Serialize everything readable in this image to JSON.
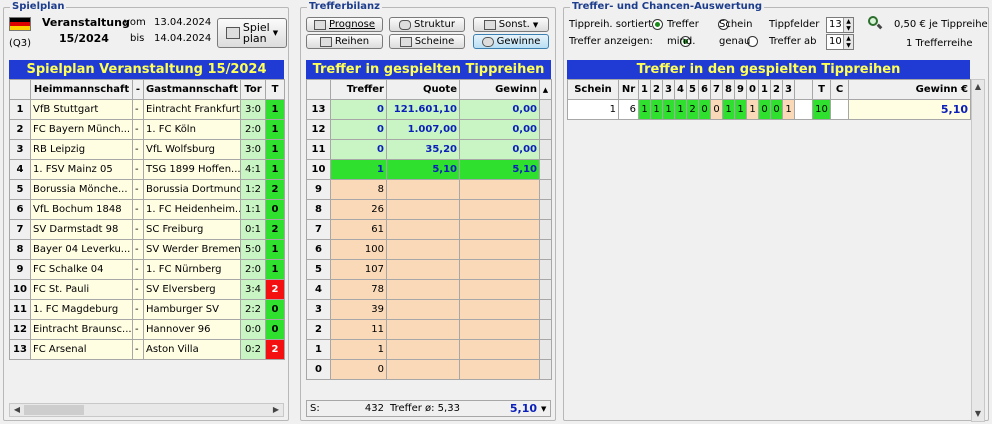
{
  "spielplan": {
    "group_title": "Spielplan",
    "veranstaltung_label": "Veranstaltung",
    "veranstaltung_nr": "15/2024",
    "q_label": "(Q3)",
    "vom_label": "vom",
    "vom_date": "13.04.2024",
    "bis_label": "bis",
    "bis_date": "14.04.2024",
    "btn_line1": "Spiel",
    "btn_line2": "plan",
    "grid_title": "Spielplan Veranstaltung 15/2024",
    "headers": [
      "Heimmannschaft",
      "-",
      "Gastmannschaft",
      "Tor",
      "T"
    ],
    "rows": [
      {
        "nr": "1",
        "home": "VfB Stuttgart",
        "dash": "-",
        "away": "Eintracht Frankfurt",
        "score": "3:0",
        "t": "1",
        "tc": "green"
      },
      {
        "nr": "2",
        "home": "FC Bayern Münch...",
        "dash": "-",
        "away": "1. FC Köln",
        "score": "2:0",
        "t": "1",
        "tc": "green"
      },
      {
        "nr": "3",
        "home": "RB Leipzig",
        "dash": "-",
        "away": "VfL Wolfsburg",
        "score": "3:0",
        "t": "1",
        "tc": "green"
      },
      {
        "nr": "4",
        "home": "1. FSV Mainz 05",
        "dash": "-",
        "away": "TSG 1899 Hoffen...",
        "score": "4:1",
        "t": "1",
        "tc": "green"
      },
      {
        "nr": "5",
        "home": "Borussia Mönche...",
        "dash": "-",
        "away": "Borussia Dortmund",
        "score": "1:2",
        "t": "2",
        "tc": "green"
      },
      {
        "nr": "6",
        "home": "VfL Bochum 1848",
        "dash": "-",
        "away": "1. FC Heidenheim...",
        "score": "1:1",
        "t": "0",
        "tc": "green"
      },
      {
        "nr": "7",
        "home": "SV Darmstadt 98",
        "dash": "-",
        "away": "SC Freiburg",
        "score": "0:1",
        "t": "2",
        "tc": "green"
      },
      {
        "nr": "8",
        "home": "Bayer 04 Leverku...",
        "dash": "-",
        "away": "SV Werder Bremen",
        "score": "5:0",
        "t": "1",
        "tc": "green"
      },
      {
        "nr": "9",
        "home": "FC Schalke 04",
        "dash": "-",
        "away": "1. FC Nürnberg",
        "score": "2:0",
        "t": "1",
        "tc": "green"
      },
      {
        "nr": "10",
        "home": "FC St. Pauli",
        "dash": "-",
        "away": "SV Elversberg",
        "score": "3:4",
        "t": "2",
        "tc": "red"
      },
      {
        "nr": "11",
        "home": "1. FC Magdeburg",
        "dash": "-",
        "away": "Hamburger SV",
        "score": "2:2",
        "t": "0",
        "tc": "green"
      },
      {
        "nr": "12",
        "home": "Eintracht Braunsc...",
        "dash": "-",
        "away": "Hannover 96",
        "score": "0:0",
        "t": "0",
        "tc": "green"
      },
      {
        "nr": "13",
        "home": "FC Arsenal",
        "dash": "-",
        "away": "Aston Villa",
        "score": "0:2",
        "t": "2",
        "tc": "red"
      }
    ]
  },
  "trefferbilanz": {
    "group_title": "Trefferbilanz",
    "buttons": {
      "prognose": "Prognose",
      "struktur": "Struktur",
      "sonst": "Sonst.",
      "reihen": "Reihen",
      "scheine": "Scheine",
      "gewinne": "Gewinne"
    },
    "grid_title": "Treffer in gespielten Tippreihen",
    "headers": [
      "Treffer",
      "Quote",
      "Gewinn"
    ],
    "rows": [
      {
        "k": "13",
        "treffer": "0",
        "quote": "121.601,10",
        "gewinn": "0,00",
        "style": "lgreen"
      },
      {
        "k": "12",
        "treffer": "0",
        "quote": "1.007,00",
        "gewinn": "0,00",
        "style": "lgreen"
      },
      {
        "k": "11",
        "treffer": "0",
        "quote": "35,20",
        "gewinn": "0,00",
        "style": "lgreen"
      },
      {
        "k": "10",
        "treffer": "1",
        "quote": "5,10",
        "gewinn": "5,10",
        "style": "green"
      },
      {
        "k": "9",
        "treffer": "8",
        "quote": "",
        "gewinn": "",
        "style": "peach"
      },
      {
        "k": "8",
        "treffer": "26",
        "quote": "",
        "gewinn": "",
        "style": "peach"
      },
      {
        "k": "7",
        "treffer": "61",
        "quote": "",
        "gewinn": "",
        "style": "peach"
      },
      {
        "k": "6",
        "treffer": "100",
        "quote": "",
        "gewinn": "",
        "style": "peach"
      },
      {
        "k": "5",
        "treffer": "107",
        "quote": "",
        "gewinn": "",
        "style": "peach"
      },
      {
        "k": "4",
        "treffer": "78",
        "quote": "",
        "gewinn": "",
        "style": "peach"
      },
      {
        "k": "3",
        "treffer": "39",
        "quote": "",
        "gewinn": "",
        "style": "peach"
      },
      {
        "k": "2",
        "treffer": "11",
        "quote": "",
        "gewinn": "",
        "style": "peach"
      },
      {
        "k": "1",
        "treffer": "1",
        "quote": "",
        "gewinn": "",
        "style": "peach"
      },
      {
        "k": "0",
        "treffer": "0",
        "quote": "",
        "gewinn": "",
        "style": "peach"
      }
    ],
    "footer": {
      "label": "S:",
      "sum": "432",
      "avg": "Treffer ø:  5,33",
      "gewinn": "5,10"
    }
  },
  "auswertung": {
    "group_title": "Treffer- und Chancen-Auswertung",
    "sortiert_label": "Tippreih. sortiert:",
    "sort_treffer": "Treffer",
    "sort_schein": "Schein",
    "anzeigen_label": "Treffer anzeigen:",
    "anz_mind": "mind.",
    "anz_genau": "genau",
    "tippfelder_label": "Tippfelder",
    "tippfelder_value": "13",
    "treffer_ab_label": "Treffer ab",
    "treffer_ab_value": "10",
    "price": "0,50 € je Tippreihe",
    "reihen_count": "1 Trefferreihe",
    "grid_title": "Treffer in den gespielten Tippreihen",
    "headers": [
      "Schein",
      "Nr",
      "1",
      "2",
      "3",
      "4",
      "5",
      "6",
      "7",
      "8",
      "9",
      "0",
      "1",
      "2",
      "3",
      "",
      "T",
      "C",
      "Gewinn €"
    ],
    "row": {
      "schein": "1",
      "nr": "6",
      "tips": [
        "1",
        "1",
        "1",
        "1",
        "2",
        "0",
        "0",
        "1",
        "1",
        "1",
        "0",
        "0",
        "1"
      ],
      "t": "10",
      "c": "",
      "gewinn": "5,10"
    }
  }
}
